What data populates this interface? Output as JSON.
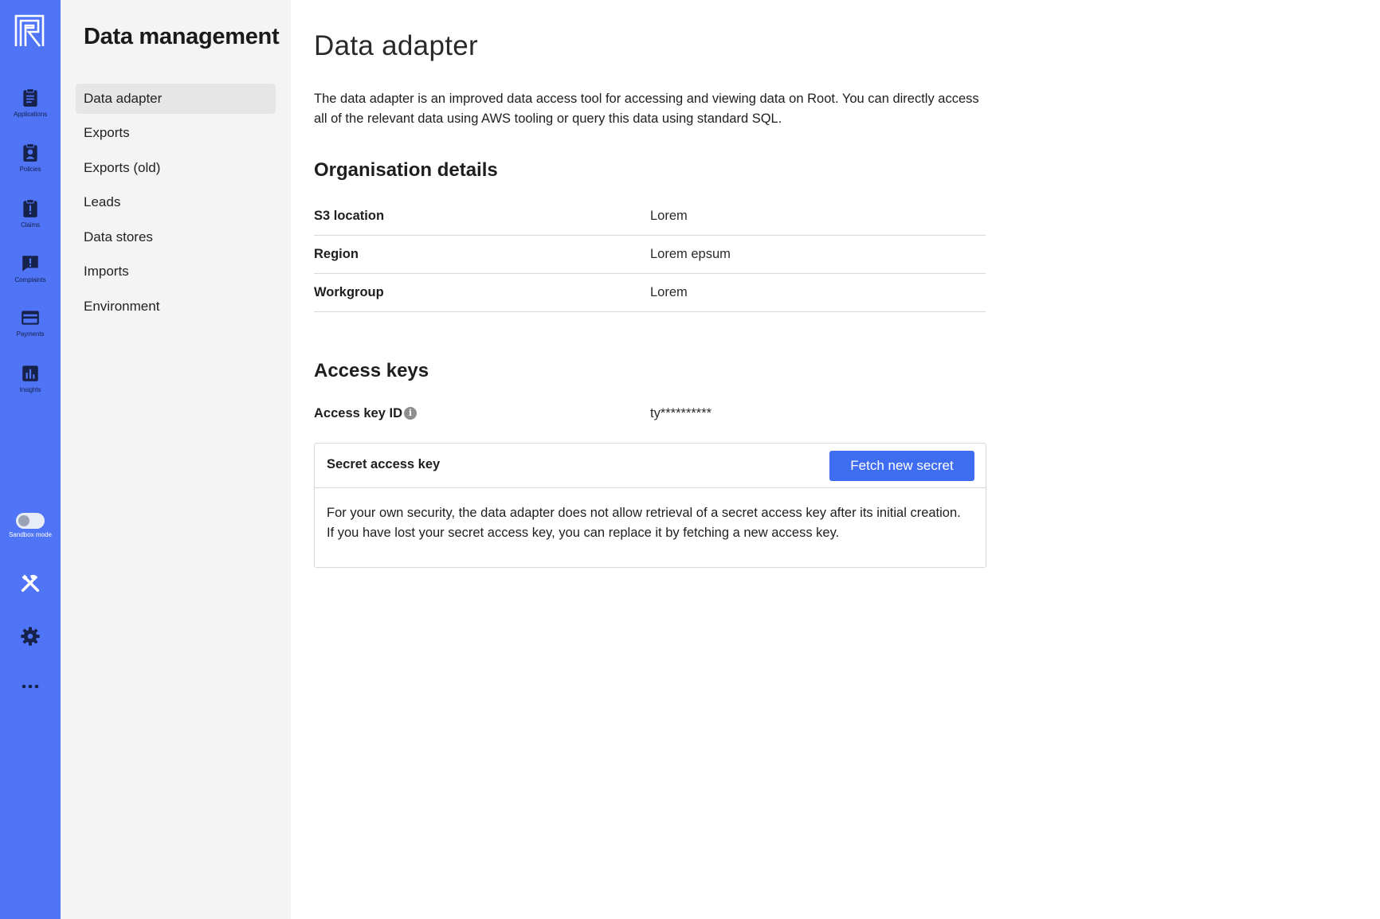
{
  "rail": {
    "items": [
      {
        "label": "Applications",
        "icon": "clipboard-list-icon"
      },
      {
        "label": "Policies",
        "icon": "clipboard-user-icon"
      },
      {
        "label": "Claims",
        "icon": "clipboard-alert-icon"
      },
      {
        "label": "Complaints",
        "icon": "chat-alert-icon"
      },
      {
        "label": "Payments",
        "icon": "credit-card-icon"
      },
      {
        "label": "Insights",
        "icon": "bar-chart-icon"
      }
    ],
    "sandbox_label": "Sandbox mode",
    "sandbox_on": false,
    "accent_color": "#4f74f6"
  },
  "subnav": {
    "title": "Data management",
    "items": [
      {
        "label": "Data adapter",
        "active": true
      },
      {
        "label": "Exports"
      },
      {
        "label": "Exports (old)"
      },
      {
        "label": "Leads"
      },
      {
        "label": "Data stores"
      },
      {
        "label": "Imports"
      },
      {
        "label": "Environment"
      }
    ]
  },
  "main": {
    "title": "Data adapter",
    "intro": "The data adapter is an improved data access tool for accessing and viewing data on Root. You can directly access all of the relevant data using AWS tooling or query this data using standard SQL.",
    "org_heading": "Organisation details",
    "org_rows": [
      {
        "key": "S3 location",
        "value": "Lorem"
      },
      {
        "key": "Region",
        "value": "Lorem epsum"
      },
      {
        "key": "Workgroup",
        "value": "Lorem"
      }
    ],
    "keys_heading": "Access keys",
    "access_key_label": "Access key ID",
    "access_key_value": "ty**********",
    "secret_label": "Secret access key",
    "fetch_button": "Fetch new secret",
    "secret_note": "For your own security, the data adapter does not allow retrieval of a secret access key after its initial creation. If you have lost your secret access key, you can replace it by fetching a new access key.",
    "button_color": "#3f6df2"
  }
}
